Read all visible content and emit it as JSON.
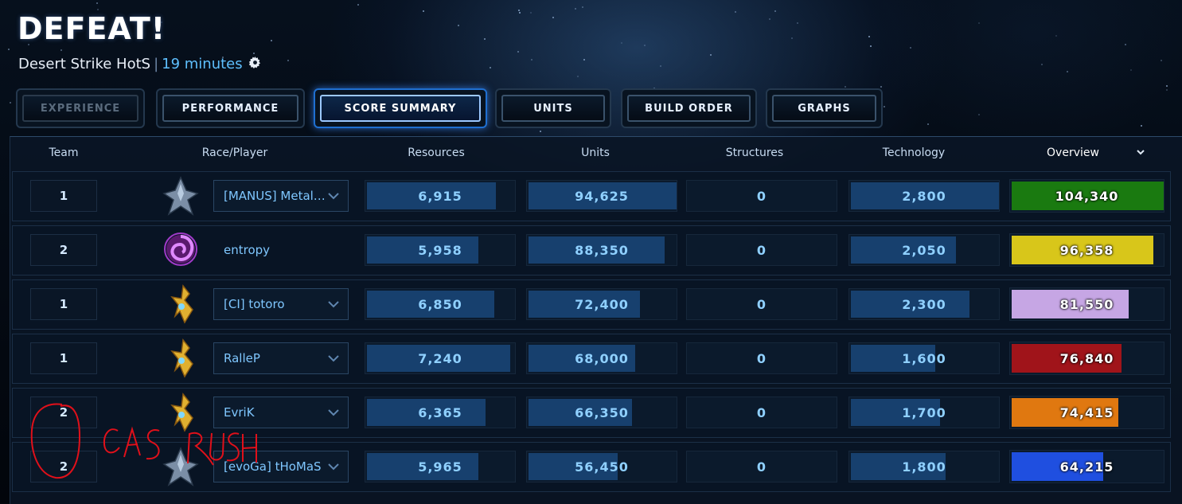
{
  "header": {
    "title": "DEFEAT!",
    "map": "Desert Strike HotS",
    "separator": "|",
    "duration": "19 minutes",
    "gear_icon": "gear-icon"
  },
  "tabs": [
    {
      "label": "EXPERIENCE",
      "state": "disabled"
    },
    {
      "label": "PERFORMANCE",
      "state": "normal"
    },
    {
      "label": "SCORE SUMMARY",
      "state": "active"
    },
    {
      "label": "UNITS",
      "state": "normal"
    },
    {
      "label": "BUILD ORDER",
      "state": "normal"
    },
    {
      "label": "GRAPHS",
      "state": "normal"
    }
  ],
  "columns": {
    "team": "Team",
    "player": "Race/Player",
    "resources": "Resources",
    "units": "Units",
    "structures": "Structures",
    "technology": "Technology",
    "overview": "Overview"
  },
  "colors": {
    "overview": [
      "#1a7a10",
      "#d8c61a",
      "#c6a6e4",
      "#a0141a",
      "#e07810",
      "#1f4fe0"
    ]
  },
  "players": [
    {
      "team": "1",
      "race": "terran",
      "name": "[MANUS] Metal…",
      "dropdown": true,
      "resources": "6,915",
      "resources_pct": 0.87,
      "units": "94,625",
      "units_pct": 1.0,
      "structures": "0",
      "technology": "2,800",
      "technology_pct": 1.0,
      "overview": "104,340",
      "overview_pct": 1.0
    },
    {
      "team": "2",
      "race": "zerg",
      "name": "entropy",
      "dropdown": false,
      "resources": "5,958",
      "resources_pct": 0.75,
      "units": "88,350",
      "units_pct": 0.92,
      "structures": "0",
      "technology": "2,050",
      "technology_pct": 0.71,
      "overview": "96,358",
      "overview_pct": 0.93
    },
    {
      "team": "1",
      "race": "protoss",
      "name": "[CI] totoro",
      "dropdown": true,
      "resources": "6,850",
      "resources_pct": 0.86,
      "units": "72,400",
      "units_pct": 0.75,
      "structures": "0",
      "technology": "2,300",
      "technology_pct": 0.8,
      "overview": "81,550",
      "overview_pct": 0.77
    },
    {
      "team": "1",
      "race": "protoss",
      "name": "RalleP",
      "dropdown": true,
      "resources": "7,240",
      "resources_pct": 0.97,
      "units": "68,000",
      "units_pct": 0.72,
      "structures": "0",
      "technology": "1,600",
      "technology_pct": 0.57,
      "overview": "76,840",
      "overview_pct": 0.72
    },
    {
      "team": "2",
      "race": "protoss",
      "name": "EvriK",
      "dropdown": true,
      "resources": "6,365",
      "resources_pct": 0.8,
      "units": "66,350",
      "units_pct": 0.7,
      "structures": "0",
      "technology": "1,700",
      "technology_pct": 0.6,
      "overview": "74,415",
      "overview_pct": 0.7
    },
    {
      "team": "2",
      "race": "terran",
      "name": "[evoGa] tHoMaS",
      "dropdown": true,
      "resources": "5,965",
      "resources_pct": 0.75,
      "units": "56,450",
      "units_pct": 0.6,
      "structures": "0",
      "technology": "1,800",
      "technology_pct": 0.64,
      "overview": "64,215",
      "overview_pct": 0.6
    }
  ],
  "annotation": {
    "text": "GAS RUSH",
    "color": "#e0101a"
  }
}
